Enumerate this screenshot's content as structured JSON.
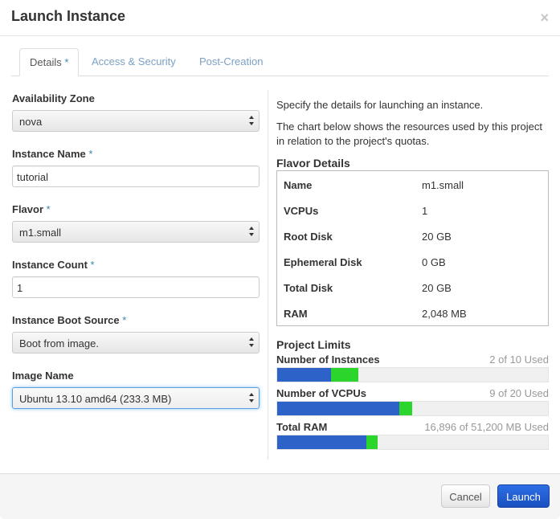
{
  "modal": {
    "title": "Launch Instance",
    "close_glyph": "×"
  },
  "tabs": [
    {
      "label": "Details",
      "required": "*",
      "active": true
    },
    {
      "label": "Access & Security",
      "active": false
    },
    {
      "label": "Post-Creation",
      "active": false
    }
  ],
  "form": {
    "required_mark": "*",
    "availability_zone": {
      "label": "Availability Zone",
      "value": "nova"
    },
    "instance_name": {
      "label": "Instance Name",
      "value": "tutorial"
    },
    "flavor": {
      "label": "Flavor",
      "value": "m1.small"
    },
    "instance_count": {
      "label": "Instance Count",
      "value": "1"
    },
    "boot_source": {
      "label": "Instance Boot Source",
      "value": "Boot from image."
    },
    "image_name": {
      "label": "Image Name",
      "value": "Ubuntu 13.10 amd64 (233.3 MB)"
    }
  },
  "info": {
    "line1": "Specify the details for launching an instance.",
    "line2": "The chart below shows the resources used by this project in relation to the project's quotas."
  },
  "flavor_details": {
    "title": "Flavor Details",
    "rows": [
      {
        "key": "Name",
        "value": "m1.small"
      },
      {
        "key": "VCPUs",
        "value": "1"
      },
      {
        "key": "Root Disk",
        "value": "20 GB"
      },
      {
        "key": "Ephemeral Disk",
        "value": "0 GB"
      },
      {
        "key": "Total Disk",
        "value": "20 GB"
      },
      {
        "key": "RAM",
        "value": "2,048 MB"
      }
    ]
  },
  "project_limits": {
    "title": "Project Limits",
    "items": [
      {
        "label": "Number of Instances",
        "used_text": "2 of 10 Used",
        "used": 2,
        "added": 1,
        "max": 10
      },
      {
        "label": "Number of VCPUs",
        "used_text": "9 of 20 Used",
        "used": 9,
        "added": 1,
        "max": 20
      },
      {
        "label": "Total RAM",
        "used_text": "16,896 of 51,200 MB Used",
        "used": 16896,
        "added": 2048,
        "max": 51200
      }
    ]
  },
  "footer": {
    "cancel_label": "Cancel",
    "launch_label": "Launch"
  },
  "colors": {
    "used_bar": "#2d63c8",
    "new_bar": "#2cd52c",
    "launch_button": "#1a4fbf",
    "link": "#7ba0c4"
  }
}
